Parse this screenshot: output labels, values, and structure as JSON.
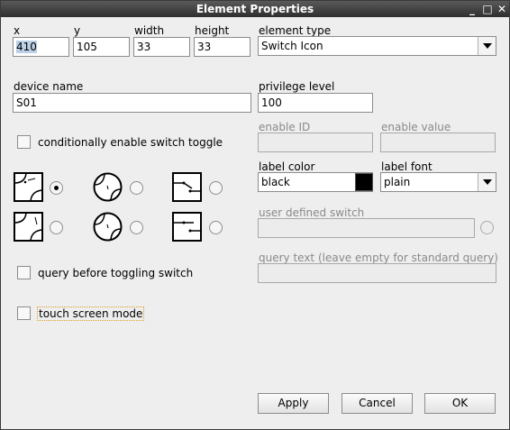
{
  "window": {
    "title": "Element Properties"
  },
  "fields": {
    "x": {
      "label": "x",
      "value": "410"
    },
    "y": {
      "label": "y",
      "value": "105"
    },
    "width": {
      "label": "width",
      "value": "33"
    },
    "height": {
      "label": "height",
      "value": "33"
    },
    "element_type": {
      "label": "element type",
      "value": "Switch Icon"
    },
    "device_name": {
      "label": "device name",
      "value": "S01"
    },
    "privilege_level": {
      "label": "privilege level",
      "value": "100"
    },
    "enable_id": {
      "label": "enable ID",
      "value": ""
    },
    "enable_value": {
      "label": "enable value",
      "value": ""
    },
    "label_color": {
      "label": "label color",
      "value": "black",
      "swatch": "#000000"
    },
    "label_font": {
      "label": "label font",
      "value": "plain"
    },
    "user_defined_switch": {
      "label": "user defined switch",
      "value": ""
    },
    "query_text": {
      "label": "query text (leave empty for standard query)",
      "value": ""
    }
  },
  "checkboxes": {
    "conditional_enable": {
      "label": "conditionally enable switch toggle",
      "checked": false
    },
    "query_before_toggling": {
      "label": "query before toggling switch",
      "checked": false
    },
    "touch_screen_mode": {
      "label": "touch screen mode",
      "checked": false
    }
  },
  "icon_options": [
    {
      "icon": "switch-curve-icon-a",
      "selected": true
    },
    {
      "icon": "rotary-switch-icon-a",
      "selected": false
    },
    {
      "icon": "knife-switch-icon-a",
      "selected": false
    },
    {
      "icon": "switch-curve-icon-b",
      "selected": false
    },
    {
      "icon": "rotary-switch-icon-b",
      "selected": false
    },
    {
      "icon": "knife-switch-icon-b",
      "selected": false
    }
  ],
  "buttons": {
    "apply": "Apply",
    "cancel": "Cancel",
    "ok": "OK"
  },
  "titlebar_buttons": {
    "minimize": "_",
    "maximize": "□",
    "close": "✕"
  }
}
